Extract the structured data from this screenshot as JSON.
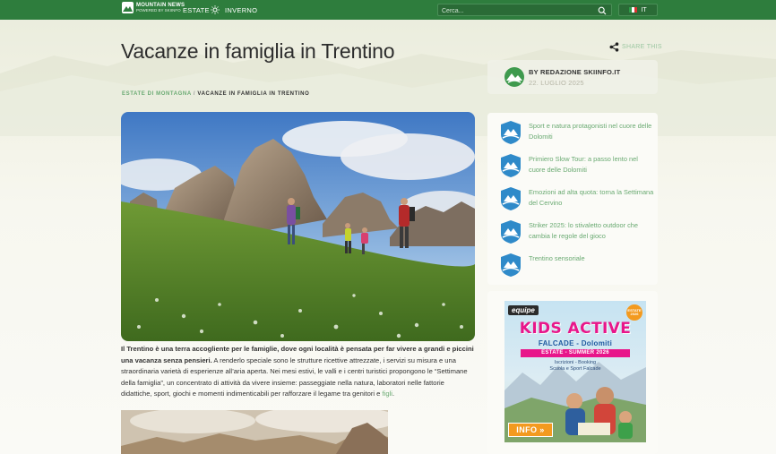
{
  "nav": {
    "logo_title": "MOUNTAIN NEWS",
    "logo_subtitle": "POWERED BY SKIINFO",
    "season_summer": "ESTATE",
    "season_winter": "INVERNO",
    "search_placeholder": "Cerca...",
    "language": "IT"
  },
  "article": {
    "title": "Vacanze in famiglia in Trentino",
    "breadcrumb_category": "ESTATE DI MONTAGNA",
    "breadcrumb_separator": "/",
    "breadcrumb_current": "VACANZE IN FAMIGLIA IN TRENTINO",
    "intro_bold": "Il Trentino è una terra accogliente per le famiglie, dove ogni località è pensata per far vivere a grandi e piccini una vacanza senza pensieri.",
    "intro_rest": " A renderlo speciale sono le strutture ricettive attrezzate, i servizi su misura e una straordinaria varietà di esperienze all’aria aperta. Nei mesi estivi, le valli e i centri turistici propongono le “Settimane della famiglia”, un concentrato di attività da vivere insieme: passeggiate nella natura, laboratori nelle fattorie didattiche, sport, giochi e momenti indimenticabili per rafforzare il legame tra genitori e ",
    "intro_link": "figli",
    "intro_end": "."
  },
  "share": {
    "label": "SHARE THIS"
  },
  "author": {
    "name": "BY REDAZIONE SKIINFO.IT",
    "date": "22. LUGLIO 2025"
  },
  "related": {
    "items": [
      {
        "title": "Sport e natura protagonisti nel cuore delle Dolomiti"
      },
      {
        "title": "Primiero Slow Tour: a passo lento nel cuore delle Dolomiti"
      },
      {
        "title": "Emozioni ad alta quota: torna la Settimana del Cervino"
      },
      {
        "title": "Striker 2025: lo stivaletto outdoor che cambia le regole del gioco"
      },
      {
        "title": "Trentino sensoriale"
      }
    ]
  },
  "ad": {
    "brand": "equipe",
    "badge": "ESTATE 2026",
    "title": "KIDS ACTIVE",
    "subtitle": "FALCADE - Dolomiti",
    "season": "ESTATE - SUMMER 2026",
    "line1": "Iscrizioni - Booking",
    "line2": "Scuola e Sport Falcade",
    "button": "INFO »"
  },
  "colors": {
    "nav_green": "#2e7d3d",
    "link_green": "#6aaa72",
    "ad_pink": "#e8168a",
    "ad_orange": "#f39a1f"
  },
  "icons": {
    "share": "share-icon",
    "search": "search-icon",
    "season_toggle": "sun-icon",
    "related": "mountain-news-badge-icon"
  }
}
